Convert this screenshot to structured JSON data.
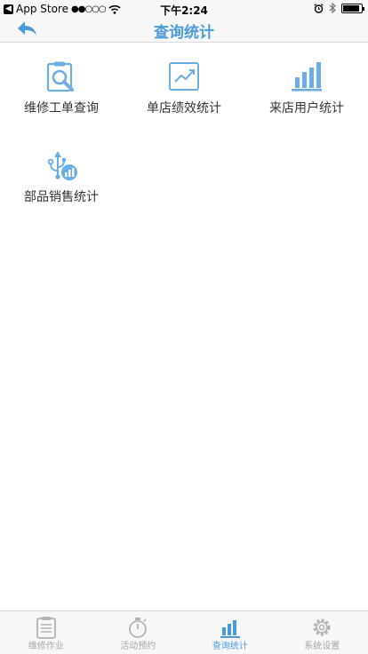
{
  "status_bar": {
    "back_app": "App Store",
    "signal": "●●○○○",
    "time": "下午2:24",
    "battery_level": 0.9
  },
  "nav": {
    "title": "查询统计"
  },
  "menu": {
    "items": [
      {
        "label": "维修工单查询",
        "icon": "clipboard-search-icon"
      },
      {
        "label": "单店绩效统计",
        "icon": "trend-chart-icon"
      },
      {
        "label": "来店用户统计",
        "icon": "bar-chart-icon"
      },
      {
        "label": "部品销售统计",
        "icon": "usb-chart-icon"
      }
    ]
  },
  "tab_bar": {
    "tabs": [
      {
        "label": "维修作业",
        "icon": "clipboard-icon",
        "active": false
      },
      {
        "label": "活动预约",
        "icon": "stopwatch-icon",
        "active": false
      },
      {
        "label": "查询统计",
        "icon": "bar-chart-icon",
        "active": true
      },
      {
        "label": "系统设置",
        "icon": "gear-icon",
        "active": false
      }
    ]
  },
  "colors": {
    "accent": "#4a9ad8",
    "tab_inactive": "#a6a6a6",
    "bar_background": "#f7f7f7"
  }
}
